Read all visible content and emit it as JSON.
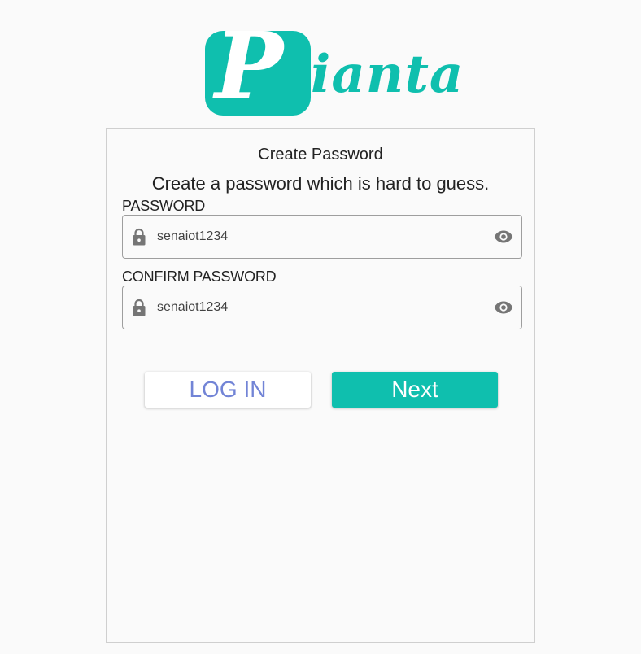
{
  "logo": {
    "initial": "P",
    "rest": "ianta",
    "brand_color": "#0fbfae"
  },
  "card": {
    "title": "Create Password",
    "subtitle": "Create a password which is hard to guess."
  },
  "password": {
    "label": "PASSWORD",
    "value": "senaiot1234",
    "lead_icon": "lock-icon",
    "trail_icon": "eye-icon"
  },
  "confirm_password": {
    "label": "CONFIRM PASSWORD",
    "value": "senaiot1234",
    "lead_icon": "lock-icon",
    "trail_icon": "eye-icon"
  },
  "buttons": {
    "login_label": "LOG IN",
    "next_label": "Next",
    "login_text_color": "#7284d6",
    "next_bg_color": "#0fbfae"
  }
}
